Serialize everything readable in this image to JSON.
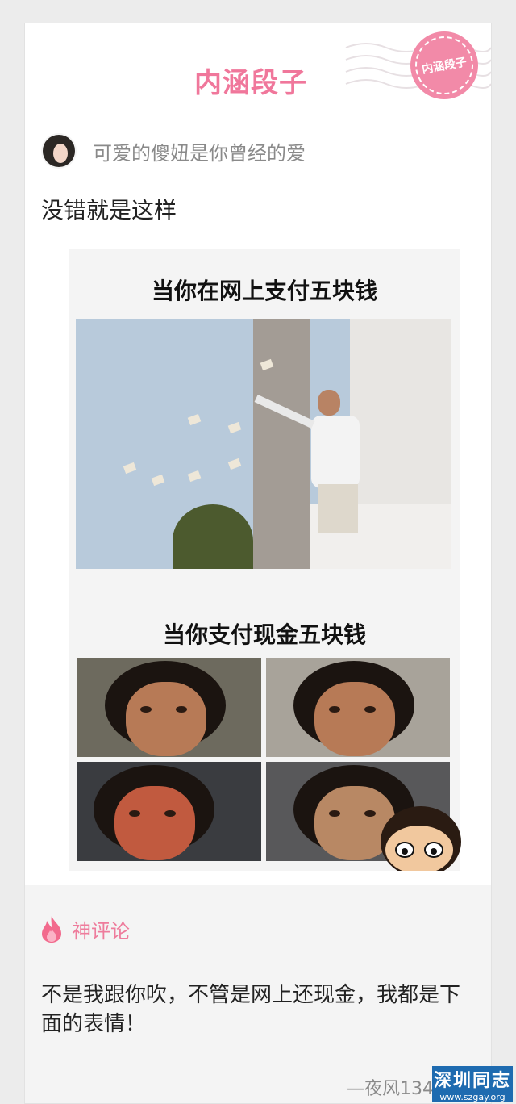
{
  "header": {
    "brand": "内涵段子",
    "stamp_text": "内涵段子"
  },
  "post": {
    "author": "可爱的傻妞是你曾经的爱",
    "text": "没错就是这样",
    "meme_top_caption": "当你在网上支付五块钱",
    "meme_bottom_caption": "当你支付现金五块钱"
  },
  "comments": {
    "label": "神评论",
    "text": "不是我跟你吹，不管是网上还现金，我都是下面的表情！",
    "author": "—夜风13408..."
  },
  "watermark": {
    "main": "深圳同志",
    "url": "www.szgay.org"
  },
  "colors": {
    "accent": "#f0779b",
    "watermark": "#1e6bb0"
  }
}
